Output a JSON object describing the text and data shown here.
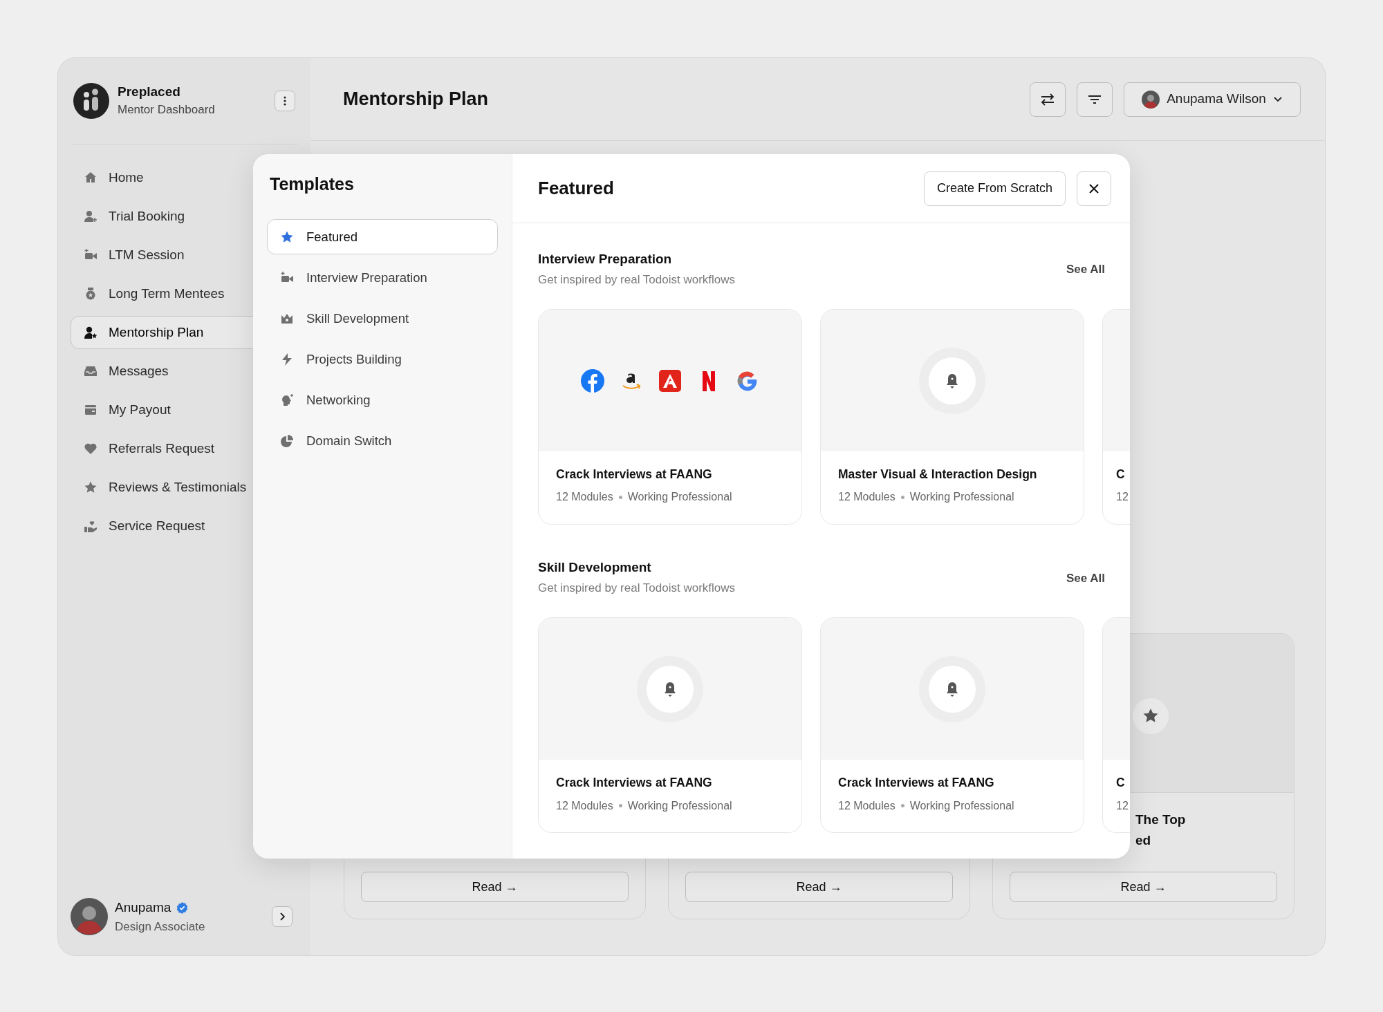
{
  "app": {
    "name": "Preplaced",
    "subtitle": "Mentor Dashboard"
  },
  "sidebar": {
    "items": [
      {
        "label": "Home",
        "selected": false
      },
      {
        "label": "Trial Booking",
        "selected": false
      },
      {
        "label": "LTM Session",
        "selected": false
      },
      {
        "label": "Long Term Mentees",
        "selected": false
      },
      {
        "label": "Mentorship Plan",
        "selected": true
      },
      {
        "label": "Messages",
        "selected": false
      },
      {
        "label": "My Payout",
        "selected": false
      },
      {
        "label": "Referrals Request",
        "selected": false
      },
      {
        "label": "Reviews & Testimonials",
        "selected": false
      },
      {
        "label": "Service Request",
        "selected": false
      }
    ]
  },
  "user": {
    "name": "Anupama",
    "role": "Design Associate",
    "verified": true
  },
  "header": {
    "title": "Mentorship Plan",
    "user_name": "Anupama Wilson"
  },
  "background_cards": [
    {
      "button": "Read →"
    },
    {
      "button": "Read →"
    },
    {
      "title_lines": [
        "The Top",
        "ed"
      ],
      "button": "Read →"
    }
  ],
  "modal": {
    "title": "Templates",
    "categories": [
      {
        "label": "Featured",
        "selected": true
      },
      {
        "label": "Interview Preparation",
        "selected": false
      },
      {
        "label": "Skill Development",
        "selected": false
      },
      {
        "label": "Projects Building",
        "selected": false
      },
      {
        "label": "Networking",
        "selected": false
      },
      {
        "label": "Domain Switch",
        "selected": false
      }
    ],
    "heading": "Featured",
    "create_button": "Create From Scratch",
    "sections": [
      {
        "title": "Interview Preparation",
        "subtitle": "Get inspired by real Todoist workflows",
        "see_all": "See All",
        "cards": [
          {
            "kind": "logos",
            "title": "Crack Interviews at FAANG",
            "modules": "12 Modules",
            "audience": "Working Professional"
          },
          {
            "kind": "bell",
            "title": "Master Visual & Interaction Design",
            "modules": "12 Modules",
            "audience": "Working Professional"
          },
          {
            "kind": "cut",
            "title": "C",
            "modules": "12"
          }
        ]
      },
      {
        "title": "Skill Development",
        "subtitle": "Get inspired by real Todoist workflows",
        "see_all": "See All",
        "cards": [
          {
            "kind": "bell",
            "title": "Crack Interviews at FAANG",
            "modules": "12 Modules",
            "audience": "Working Professional"
          },
          {
            "kind": "bell",
            "title": "Crack Interviews at FAANG",
            "modules": "12 Modules",
            "audience": "Working Professional"
          },
          {
            "kind": "cut",
            "title": "C",
            "modules": "12"
          }
        ]
      }
    ]
  }
}
